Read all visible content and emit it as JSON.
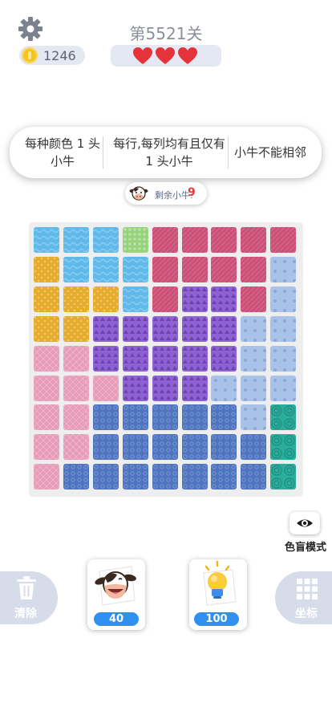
{
  "header": {
    "level_title": "第5521关",
    "coins": "1246",
    "hearts": 3,
    "settings_icon": "gear-icon",
    "coin_icon": "coin-icon",
    "heart_icon": "heart-icon"
  },
  "rules": [
    "每种颜色 1 头小牛",
    "每行,每列均有且仅有 1 头小牛",
    "小牛不能相邻"
  ],
  "remaining": {
    "label": "剩余小牛:",
    "count": "9",
    "icon": "cow-icon"
  },
  "board": {
    "size": 9,
    "colors": {
      "sky": "#5fb9e9",
      "lime": "#95d27a",
      "rose": "#cc4f78",
      "gold": "#e6ac2d",
      "lightblue": "#a9c2e9",
      "purple": "#8d62d4",
      "pink": "#e79bb8",
      "blue": "#4f74c0",
      "teal": "#2cad9c"
    },
    "grid": [
      [
        "sky",
        "sky",
        "sky",
        "lime",
        "rose",
        "rose",
        "rose",
        "rose",
        "rose"
      ],
      [
        "gold",
        "sky",
        "sky",
        "sky",
        "rose",
        "rose",
        "rose",
        "rose",
        "lightblue"
      ],
      [
        "gold",
        "gold",
        "gold",
        "sky",
        "rose",
        "purple",
        "purple",
        "rose",
        "lightblue"
      ],
      [
        "gold",
        "gold",
        "purple",
        "purple",
        "purple",
        "purple",
        "purple",
        "lightblue",
        "lightblue"
      ],
      [
        "pink",
        "pink",
        "purple",
        "purple",
        "purple",
        "purple",
        "purple",
        "lightblue",
        "lightblue"
      ],
      [
        "pink",
        "pink",
        "pink",
        "purple",
        "purple",
        "purple",
        "lightblue",
        "lightblue",
        "lightblue"
      ],
      [
        "pink",
        "pink",
        "blue",
        "blue",
        "blue",
        "blue",
        "blue",
        "lightblue",
        "teal"
      ],
      [
        "pink",
        "pink",
        "blue",
        "blue",
        "blue",
        "blue",
        "blue",
        "blue",
        "teal"
      ],
      [
        "pink",
        "blue",
        "blue",
        "blue",
        "blue",
        "blue",
        "blue",
        "blue",
        "teal"
      ]
    ]
  },
  "colorblind": {
    "label": "色盲模式",
    "icon": "eye-icon"
  },
  "toolbar": {
    "clear_label": "清除",
    "clear_icon": "trash-icon",
    "cow_price": "40",
    "cow_icon": "cow-icon",
    "hint_price": "100",
    "hint_icon": "lightbulb-icon",
    "coord_label": "坐标",
    "coord_icon": "grid-icon"
  }
}
